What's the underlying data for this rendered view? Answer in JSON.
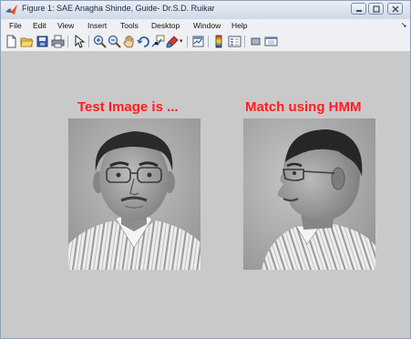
{
  "window": {
    "title": "Figure 1: SAE Anagha Shinde, Guide- Dr.S.D. Ruikar"
  },
  "menu": {
    "items": [
      "File",
      "Edit",
      "View",
      "Insert",
      "Tools",
      "Desktop",
      "Window",
      "Help"
    ]
  },
  "toolbar": {
    "buttons": [
      "new-figure",
      "open-file",
      "save-figure",
      "print-figure",
      "edit-plot",
      "zoom-in",
      "zoom-out",
      "pan",
      "rotate-3d",
      "data-cursor",
      "brush",
      "link-plot",
      "insert-colorbar",
      "insert-legend",
      "hide-plot-tools",
      "show-plot-tools"
    ]
  },
  "figure": {
    "left_title": "Test Image is ...",
    "right_title": "Match using HMM",
    "title_color": "#ff1e1e",
    "background": "#c9c9c9"
  }
}
